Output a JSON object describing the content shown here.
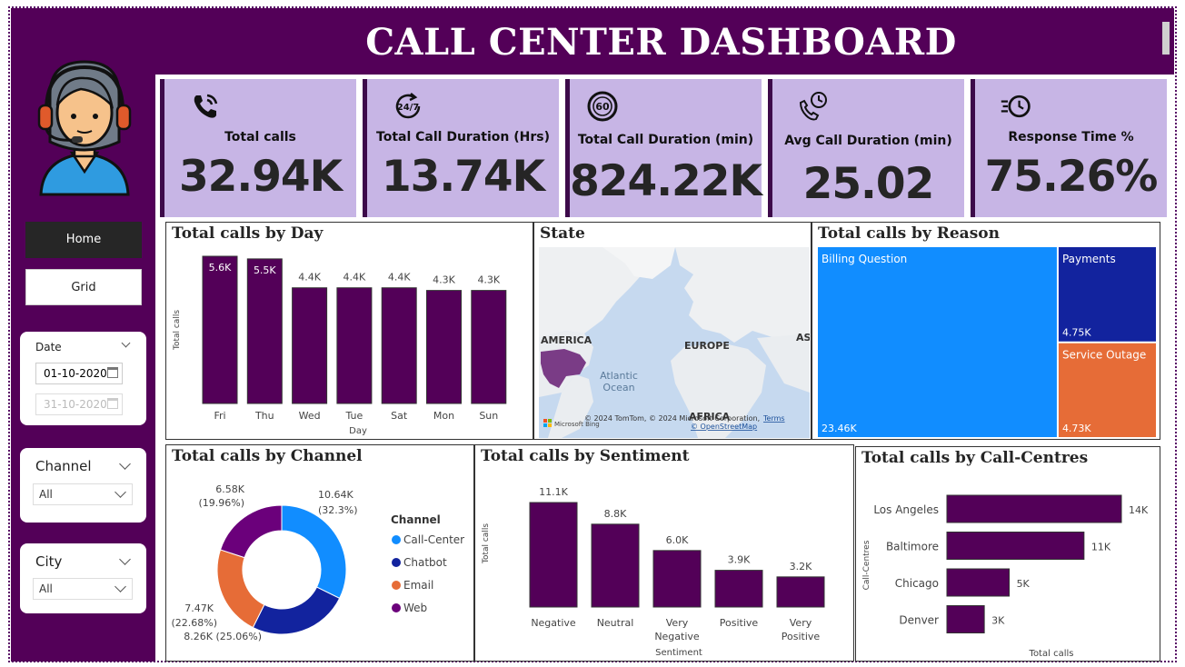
{
  "header": {
    "title": "CALL CENTER DASHBOARD"
  },
  "nav": {
    "home": "Home",
    "grid": "Grid"
  },
  "slicers": {
    "date": {
      "label": "Date",
      "start": "01-10-2020",
      "end": "31-10-2020"
    },
    "channel": {
      "label": "Channel",
      "value": "All"
    },
    "city": {
      "label": "City",
      "value": "All"
    }
  },
  "kpis": [
    {
      "label": "Total calls",
      "value": "32.94K",
      "icon": "phone-ringing-icon"
    },
    {
      "label": "Total Call Duration (Hrs)",
      "value": "13.74K",
      "icon": "24-7-icon"
    },
    {
      "label": "Total Call Duration (min)",
      "value": "824.22K",
      "icon": "60-timer-icon"
    },
    {
      "label": "Avg Call Duration (min)",
      "value": "25.02",
      "icon": "phone-clock-icon"
    },
    {
      "label": "Response Time %",
      "value": "75.26%",
      "icon": "fast-clock-icon"
    }
  ],
  "map": {
    "title": "State",
    "labels": {
      "america": "AMERICA",
      "europe": "EUROPE",
      "asia": "AS",
      "africa": "AFRICA",
      "ocean1": "Atlantic",
      "ocean2": "Ocean"
    },
    "copyright": "© 2024 TomTom, © 2024 Microsoft Corporation,",
    "terms": "Terms",
    "osm": "© OpenStreetMap",
    "bing": "Microsoft Bing"
  },
  "chart_data": [
    {
      "id": "day",
      "type": "bar",
      "title": "Total calls by Day",
      "xlabel": "Day",
      "ylabel": "Total calls",
      "categories": [
        "Fri",
        "Thu",
        "Wed",
        "Tue",
        "Sat",
        "Mon",
        "Sun"
      ],
      "values": [
        5600,
        5500,
        4400,
        4400,
        4400,
        4300,
        4300
      ],
      "data_labels": [
        "5.6K",
        "5.5K",
        "4.4K",
        "4.4K",
        "4.4K",
        "4.3K",
        "4.3K"
      ],
      "ylim": [
        0,
        5600
      ],
      "color": "#530058"
    },
    {
      "id": "reason",
      "type": "treemap",
      "title": "Total calls by Reason",
      "categories": [
        "Billing Question",
        "Payments",
        "Service Outage"
      ],
      "values": [
        23460,
        4750,
        4730
      ],
      "data_labels": [
        "23.46K",
        "4.75K",
        "4.73K"
      ],
      "colors": [
        "#118dff",
        "#12239e",
        "#e66c37"
      ]
    },
    {
      "id": "channel",
      "type": "pie",
      "title": "Total calls by Channel",
      "legend_title": "Channel",
      "categories": [
        "Call-Center",
        "Chatbot",
        "Email",
        "Web"
      ],
      "values": [
        10640,
        8260,
        7470,
        6580
      ],
      "data_labels": [
        "10.64K",
        "8.26K (25.06%)",
        "7.47K",
        "6.58K"
      ],
      "percent_labels": [
        "(32.3%)",
        "",
        "(22.68%)",
        "(19.96%)"
      ],
      "colors": [
        "#118dff",
        "#12239e",
        "#e66c37",
        "#6b007b"
      ]
    },
    {
      "id": "sentiment",
      "type": "bar",
      "title": "Total calls by Sentiment",
      "xlabel": "Sentiment",
      "ylabel": "Total calls",
      "categories": [
        "Negative",
        "Neutral",
        "Very Negative",
        "Positive",
        "Very Positive"
      ],
      "values": [
        11100,
        8800,
        6000,
        3900,
        3200
      ],
      "data_labels": [
        "11.1K",
        "8.8K",
        "6.0K",
        "3.9K",
        "3.2K"
      ],
      "ylim": [
        0,
        11100
      ],
      "color": "#530058"
    },
    {
      "id": "centres",
      "type": "bar",
      "orientation": "horizontal",
      "title": "Total calls by Call-Centres",
      "xlabel": "Total calls",
      "ylabel": "Call-Centres",
      "categories": [
        "Los Angeles",
        "Baltimore",
        "Chicago",
        "Denver"
      ],
      "values": [
        14000,
        11000,
        5000,
        3000
      ],
      "data_labels": [
        "14K",
        "11K",
        "5K",
        "3K"
      ],
      "xlim": [
        0,
        14000
      ],
      "color": "#530058"
    }
  ]
}
